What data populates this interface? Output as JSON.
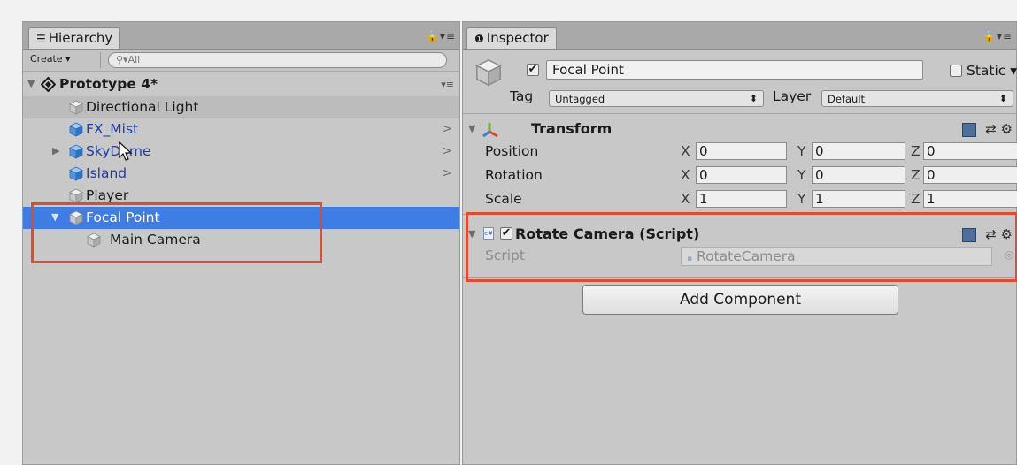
{
  "hierarchy": {
    "tab_label": "Hierarchy",
    "tab_icon": "hierarchy-list-icon",
    "create_label": "Create",
    "search_placeholder": "All",
    "scene_name": "Prototype 4*",
    "items": [
      {
        "label": "Directional Light",
        "type": "gameobject"
      },
      {
        "label": "FX_Mist",
        "type": "prefab",
        "has_children": true
      },
      {
        "label": "SkyDome",
        "type": "prefab",
        "has_children": true
      },
      {
        "label": "Island",
        "type": "prefab",
        "has_children": true
      },
      {
        "label": "Player",
        "type": "gameobject"
      },
      {
        "label": "Focal Point",
        "type": "gameobject",
        "selected": true,
        "expanded": true
      },
      {
        "label": "Main Camera",
        "type": "gameobject",
        "child_of": "Focal Point"
      }
    ]
  },
  "inspector": {
    "tab_label": "Inspector",
    "tab_icon": "info-icon",
    "object_name": "Focal Point",
    "active": true,
    "static_label": "Static",
    "static_checked": false,
    "tag_label": "Tag",
    "tag_value": "Untagged",
    "layer_label": "Layer",
    "layer_value": "Default",
    "transform": {
      "title": "Transform",
      "position_label": "Position",
      "rotation_label": "Rotation",
      "scale_label": "Scale",
      "axis_x": "X",
      "axis_y": "Y",
      "axis_z": "Z",
      "position": {
        "x": "0",
        "y": "0",
        "z": "0"
      },
      "rotation": {
        "x": "0",
        "y": "0",
        "z": "0"
      },
      "scale": {
        "x": "1",
        "y": "1",
        "z": "1"
      }
    },
    "script_component": {
      "title": "Rotate Camera (Script)",
      "enabled": true,
      "script_label": "Script",
      "script_value": "RotateCamera"
    },
    "add_component_label": "Add Component"
  },
  "colors": {
    "selection": "#3e7de3",
    "highlight_box": "#e24a2b",
    "prefab_text": "#1f3e9e",
    "panel_bg": "#c8c8c8"
  }
}
